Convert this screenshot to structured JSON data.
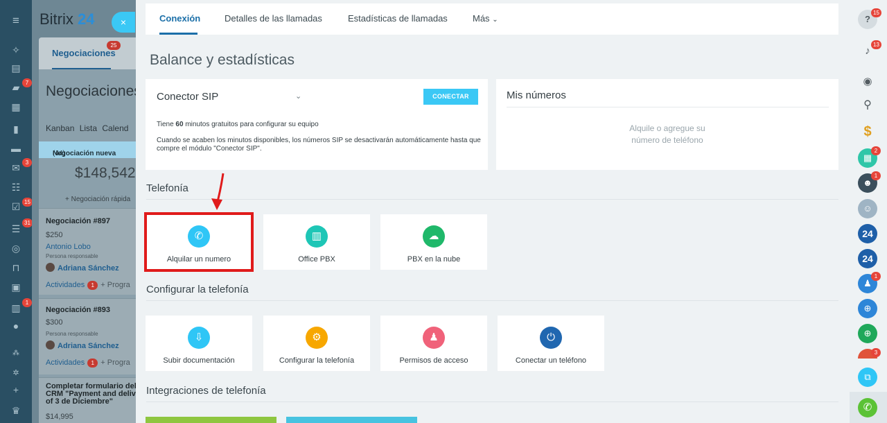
{
  "app": {
    "name": "Bitrix",
    "name_num": "24"
  },
  "leftnav": {
    "badges": [
      "7",
      "3",
      "15",
      "31",
      "1"
    ]
  },
  "background": {
    "tab_label": "Negociaciones",
    "tab_badge": "25",
    "page_title": "Negociaciones",
    "view_tabs": "Kanban  Lista  Calend",
    "stage_name": "Negociación nueva",
    "stage_count": "(44)",
    "stage_total": "$148,542",
    "quick_add": "+ Negociación rápida",
    "responsible_label": "Persona responsable",
    "activities_label": "Actividades",
    "activities_badge": "1",
    "add_activity": "+ Progra",
    "cards": [
      {
        "name": "Negociación #897",
        "amount": "$250",
        "client": "Antonio Lobo",
        "person": "Adriana Sánchez"
      },
      {
        "name": "Negociación #893",
        "amount": "$300",
        "person": "Adriana Sánchez"
      },
      {
        "name_line1": "Completar formulario del",
        "name_line2": "CRM \"Payment and delive",
        "name_line3": "of 3 de Diciembre\"",
        "amount": "$14,995"
      }
    ]
  },
  "close_icon": "×",
  "tabs": [
    {
      "label": "Conexión",
      "active": true
    },
    {
      "label": "Detalles de las llamadas"
    },
    {
      "label": "Estadísticas de llamadas"
    },
    {
      "label": "Más"
    }
  ],
  "page_title": "Balance y estadísticas",
  "sip": {
    "title": "Conector SIP",
    "button": "CONECTAR",
    "line1_pre": "Tiene ",
    "line1_bold": "60",
    "line1_post": " minutos gratuitos para configurar su equipo",
    "line2": "Cuando se acaben los minutos disponibles, los números SIP se desactivarán automáticamente hasta que compre el módulo \"Conector SIP\"."
  },
  "my_numbers": {
    "title": "Mis números",
    "empty_line1": "Alquile o agregue su",
    "empty_line2": "número de teléfono"
  },
  "telephony": {
    "title": "Telefonía",
    "tiles": [
      {
        "label": "Alquilar un numero",
        "icon": "phone-dollar-icon",
        "color": "#2fc6f6"
      },
      {
        "label": "Office PBX",
        "icon": "pbx-icon",
        "color": "#1ec6b6"
      },
      {
        "label": "PBX en la nube",
        "icon": "cloud-pbx-icon",
        "color": "#1fb86a"
      }
    ]
  },
  "configure": {
    "title": "Configurar la telefonía",
    "tiles": [
      {
        "label": "Subir documentación",
        "icon": "upload-document-icon",
        "color": "#2fc6f6"
      },
      {
        "label": "Configurar la telefonía",
        "icon": "settings-icon",
        "color": "#f7a700"
      },
      {
        "label": "Permisos de acceso",
        "icon": "access-permissions-icon",
        "color": "#f0627a"
      },
      {
        "label": "Conectar un teléfono",
        "icon": "plug-icon",
        "color": "#2067b0"
      }
    ]
  },
  "integrations": {
    "title": "Integraciones de telefonía"
  },
  "rightbar": {
    "help_badge": "15",
    "notifications_badge": "13",
    "calendar_badge": "2",
    "group_badge": "1",
    "users_badge": "1",
    "chat_badge": "3"
  },
  "colors": {
    "accent": "#3bc8f5",
    "link": "#1b6fa8",
    "highlight": "#e01b1b"
  }
}
